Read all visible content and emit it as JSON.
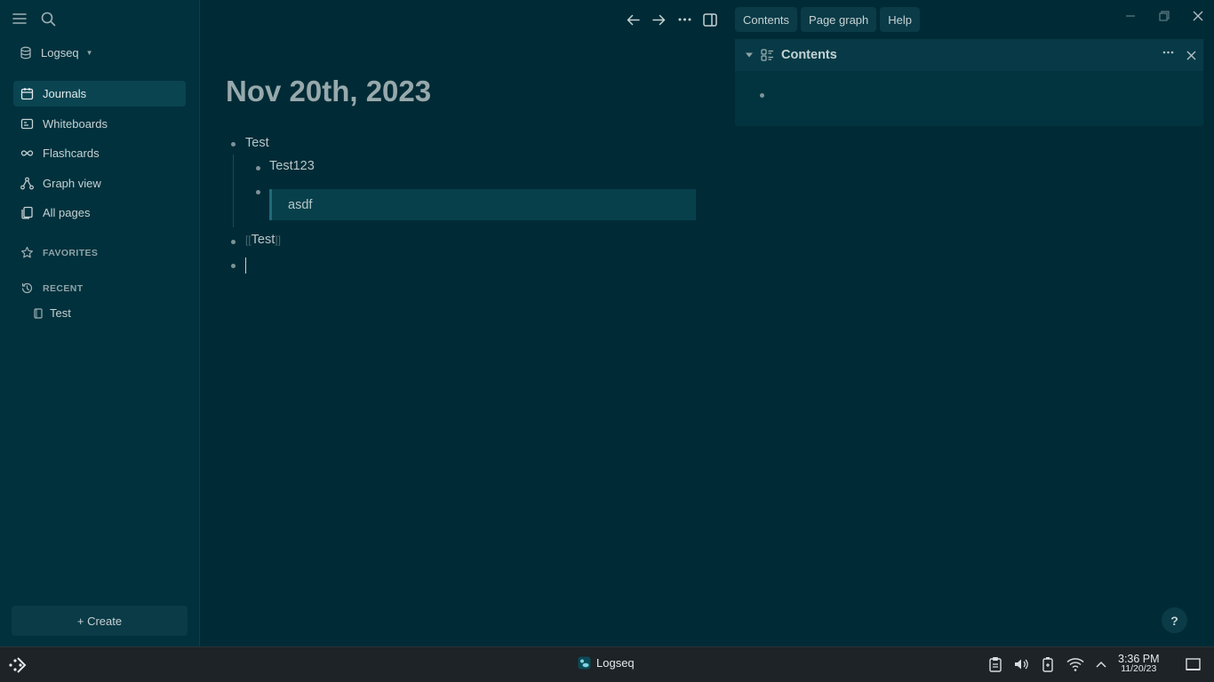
{
  "sidebar": {
    "graph_name": "Logseq",
    "nav": [
      {
        "label": "Journals"
      },
      {
        "label": "Whiteboards"
      },
      {
        "label": "Flashcards"
      },
      {
        "label": "Graph view"
      },
      {
        "label": "All pages"
      }
    ],
    "favorites_label": "FAVORITES",
    "recent_label": "RECENT",
    "recent_items": [
      {
        "label": "Test"
      }
    ],
    "create_label": "+ Create"
  },
  "right_tabs": [
    {
      "label": "Contents"
    },
    {
      "label": "Page graph"
    },
    {
      "label": "Help"
    }
  ],
  "page": {
    "title": "Nov 20th, 2023",
    "blocks": {
      "b1": "Test",
      "b1_1": "Test123",
      "b1_2_quote": "asdf",
      "b2_ref": "Test"
    }
  },
  "right_panel": {
    "title": "Contents"
  },
  "help_label": "?",
  "taskbar": {
    "app_label": "Logseq",
    "time": "3:36 PM",
    "date": "11/20/23"
  },
  "colors": {
    "background": "#002b36",
    "sidebar": "#01313d",
    "active": "#0a4451",
    "accent": "#1f6a7a"
  }
}
